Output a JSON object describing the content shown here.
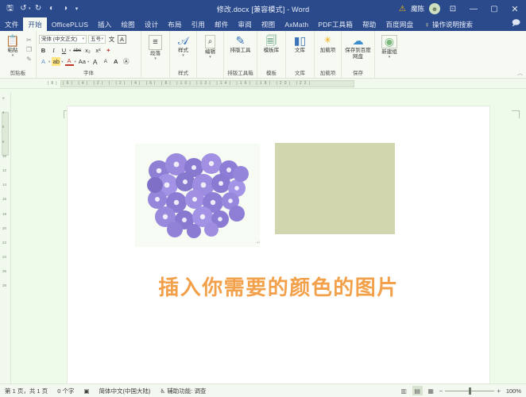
{
  "window": {
    "title": "修改.docx [兼容模式] - Word",
    "user_name": "魔陈",
    "warning_icon": "warning-triangle-icon",
    "avatar_icon": "user-avatar-icon",
    "ribbon_display_icon": "ribbon-display-options-icon",
    "minimize_label": "—",
    "maximize_label": "▢",
    "close_label": "✕",
    "accent_color": "#2b4a8b"
  },
  "quick_access": [
    {
      "name": "save",
      "icon": "save-icon",
      "glyph": "🖫"
    },
    {
      "name": "undo",
      "icon": "undo-icon",
      "glyph": "↺"
    },
    {
      "name": "undo-dropdown",
      "icon": "chevron-down-icon",
      "glyph": "▾"
    },
    {
      "name": "redo",
      "icon": "redo-icon",
      "glyph": "↻"
    },
    {
      "name": "quick-print",
      "icon": "print-icon",
      "glyph": "◐"
    },
    {
      "name": "touch-mode",
      "icon": "touch-mode-icon",
      "glyph": "◑"
    },
    {
      "name": "customize",
      "icon": "chevron-down-icon",
      "glyph": "▾"
    }
  ],
  "tabs": [
    {
      "label": "文件",
      "active": false
    },
    {
      "label": "开始",
      "active": true
    },
    {
      "label": "OfficePLUS",
      "active": false
    },
    {
      "label": "插入",
      "active": false
    },
    {
      "label": "绘图",
      "active": false
    },
    {
      "label": "设计",
      "active": false
    },
    {
      "label": "布局",
      "active": false
    },
    {
      "label": "引用",
      "active": false
    },
    {
      "label": "邮件",
      "active": false
    },
    {
      "label": "审阅",
      "active": false
    },
    {
      "label": "视图",
      "active": false
    },
    {
      "label": "AxMath",
      "active": false
    },
    {
      "label": "PDF工具箱",
      "active": false
    },
    {
      "label": "帮助",
      "active": false
    },
    {
      "label": "百度网盘",
      "active": false
    }
  ],
  "tell_me": {
    "label": "操作说明搜索",
    "icon": "lightbulb-icon"
  },
  "comment_icon": "comment-icon",
  "ribbon": {
    "clipboard": {
      "group_label": "剪贴板",
      "paste_label": "粘贴",
      "paste_icon": "paste-icon",
      "cut_icon": "scissors-icon",
      "copy_icon": "copy-icon",
      "format_painter_icon": "format-painter-icon",
      "dialog_launcher": "dialog-launcher-icon"
    },
    "font": {
      "group_label": "字体",
      "font_name": "宋体 (中文正文)",
      "font_size": "五号",
      "phonetic_guide_icon": "phonetic-guide-icon",
      "char_border_icon": "character-border-icon",
      "bold": "B",
      "italic": "I",
      "underline": "U",
      "strikethrough": "abc",
      "subscript": "x₂",
      "superscript": "x²",
      "clear_format_icon": "clear-formatting-icon",
      "text_effects_icon": "text-effects-icon",
      "highlight_icon": "text-highlight-icon",
      "font_color_icon": "font-color-icon",
      "char_shading_icon": "character-shading-icon",
      "grow_font": "A",
      "shrink_font": "A",
      "char_scaling_icon": "character-scaling-icon",
      "enclose_char_icon": "enclose-character-icon",
      "dialog_launcher": "dialog-launcher-icon"
    },
    "paragraph": {
      "group_label": "段落",
      "button_label": "段落",
      "icon": "paragraph-icon"
    },
    "styles": {
      "group_label": "样式",
      "button_label": "样式",
      "icon": "styles-icon",
      "dialog_launcher": "dialog-launcher-icon"
    },
    "editing": {
      "group_label": "编辑",
      "button_label": "编辑",
      "icon": "find-magnifier-icon"
    },
    "typeset_toolbox": {
      "group_label": "排版工具箱",
      "button_label": "排版工具",
      "icon": "typeset-pen-icon"
    },
    "template": {
      "group_label": "模板",
      "button_label": "模板库",
      "icon": "template-library-icon"
    },
    "library": {
      "group_label": "文库",
      "button_label": "文库",
      "icon": "book-library-icon"
    },
    "addins": {
      "group_label": "加载项",
      "button_label": "加载项",
      "icon": "addin-icon"
    },
    "save_group": {
      "group_label": "保存",
      "button_label": "保存到百度网盘",
      "icon": "baidu-netdisk-icon"
    },
    "new_group": {
      "button_label": "新建组",
      "icon": "new-group-icon"
    },
    "collapse_ribbon_icon": "collapse-ribbon-chevron-icon"
  },
  "ruler": {
    "horizontal_numbers": "|8|  |6|  |4|  |2|  |   |2|  |4|  |6|  |8|  |10| |12| |14| |16| |18| |20| |22|",
    "vertical_numbers": [
      "2",
      "",
      "4",
      "",
      "6",
      "",
      "8",
      "",
      "10",
      "",
      "12",
      "",
      "14",
      "",
      "16",
      "",
      "18",
      "",
      "20",
      "",
      "22",
      "",
      "24",
      "",
      "26",
      "",
      "28"
    ]
  },
  "document": {
    "heading_text": "插入你需要的颜色的图片",
    "heading_color": "#f3a04a",
    "image_left": {
      "name": "purple-flowers-photo",
      "alt": "紫色花朵图片",
      "bg": "#f4fbf0"
    },
    "image_right": {
      "name": "khaki-color-block",
      "alt": "卡其色色块图片",
      "color": "#d2d6ae"
    },
    "paragraph_mark": "↵"
  },
  "status_bar": {
    "page": "第 1 页，共 1 页",
    "word_count": "0 个字",
    "proofing_icon": "proofing-errors-icon",
    "language": "简体中文(中国大陆)",
    "accessibility_icon": "accessibility-icon",
    "accessibility": "辅助功能: 调查",
    "views": [
      {
        "name": "read-mode-view",
        "glyph": "▥",
        "active": false
      },
      {
        "name": "print-layout-view",
        "glyph": "▤",
        "active": true
      },
      {
        "name": "web-layout-view",
        "glyph": "▦",
        "active": false
      }
    ],
    "zoom_out": "−",
    "zoom_in": "+",
    "zoom_level": "100%"
  }
}
